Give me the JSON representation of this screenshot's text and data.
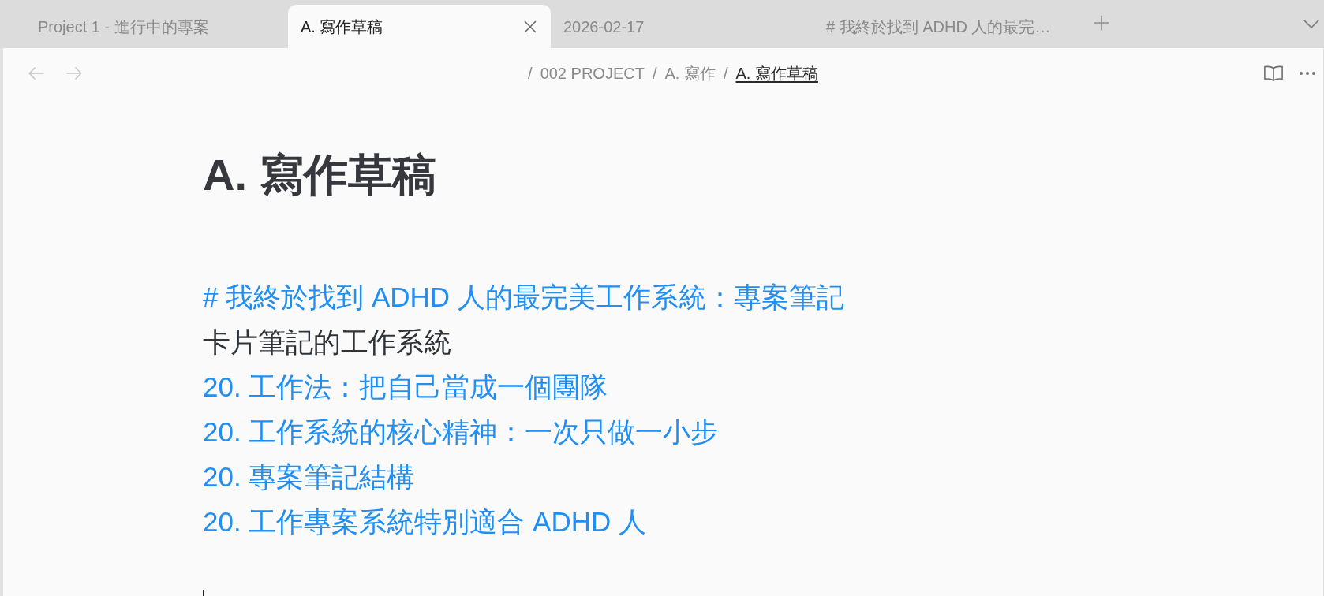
{
  "tabs": [
    {
      "label": "Project 1 - 進行中的專案",
      "selected": false
    },
    {
      "label": "A. 寫作草稿",
      "selected": true
    },
    {
      "label": "2026-02-17",
      "selected": false
    },
    {
      "label": "# 我終於找到 ADHD 人的最完…",
      "selected": false
    }
  ],
  "header": {
    "nav": [
      {
        "kind": "back",
        "disabled": true
      },
      {
        "kind": "forward",
        "disabled": true
      }
    ],
    "breadcrumb": [
      {
        "separator": "/",
        "label": "002 PROJECT",
        "current": false
      },
      {
        "separator": "/",
        "label": "A. 寫作",
        "current": false
      },
      {
        "separator": "/",
        "label": "A. 寫作草稿",
        "current": true
      }
    ]
  },
  "note": {
    "title": "A. 寫作草稿",
    "lines": [
      {
        "kind": "link",
        "text": "# 我終於找到 ADHD 人的最完美工作系統：專案筆記"
      },
      {
        "kind": "text",
        "text": "卡片筆記的工作系統"
      },
      {
        "kind": "link",
        "text": "20. 工作法：把自己當成一個團隊"
      },
      {
        "kind": "link",
        "text": "20. 工作系統的核心精神：一次只做一小步"
      },
      {
        "kind": "link",
        "text": "20. 專案筆記結構"
      },
      {
        "kind": "link",
        "text": "20. 工作專案系統特別適合 ADHD 人"
      }
    ]
  }
}
